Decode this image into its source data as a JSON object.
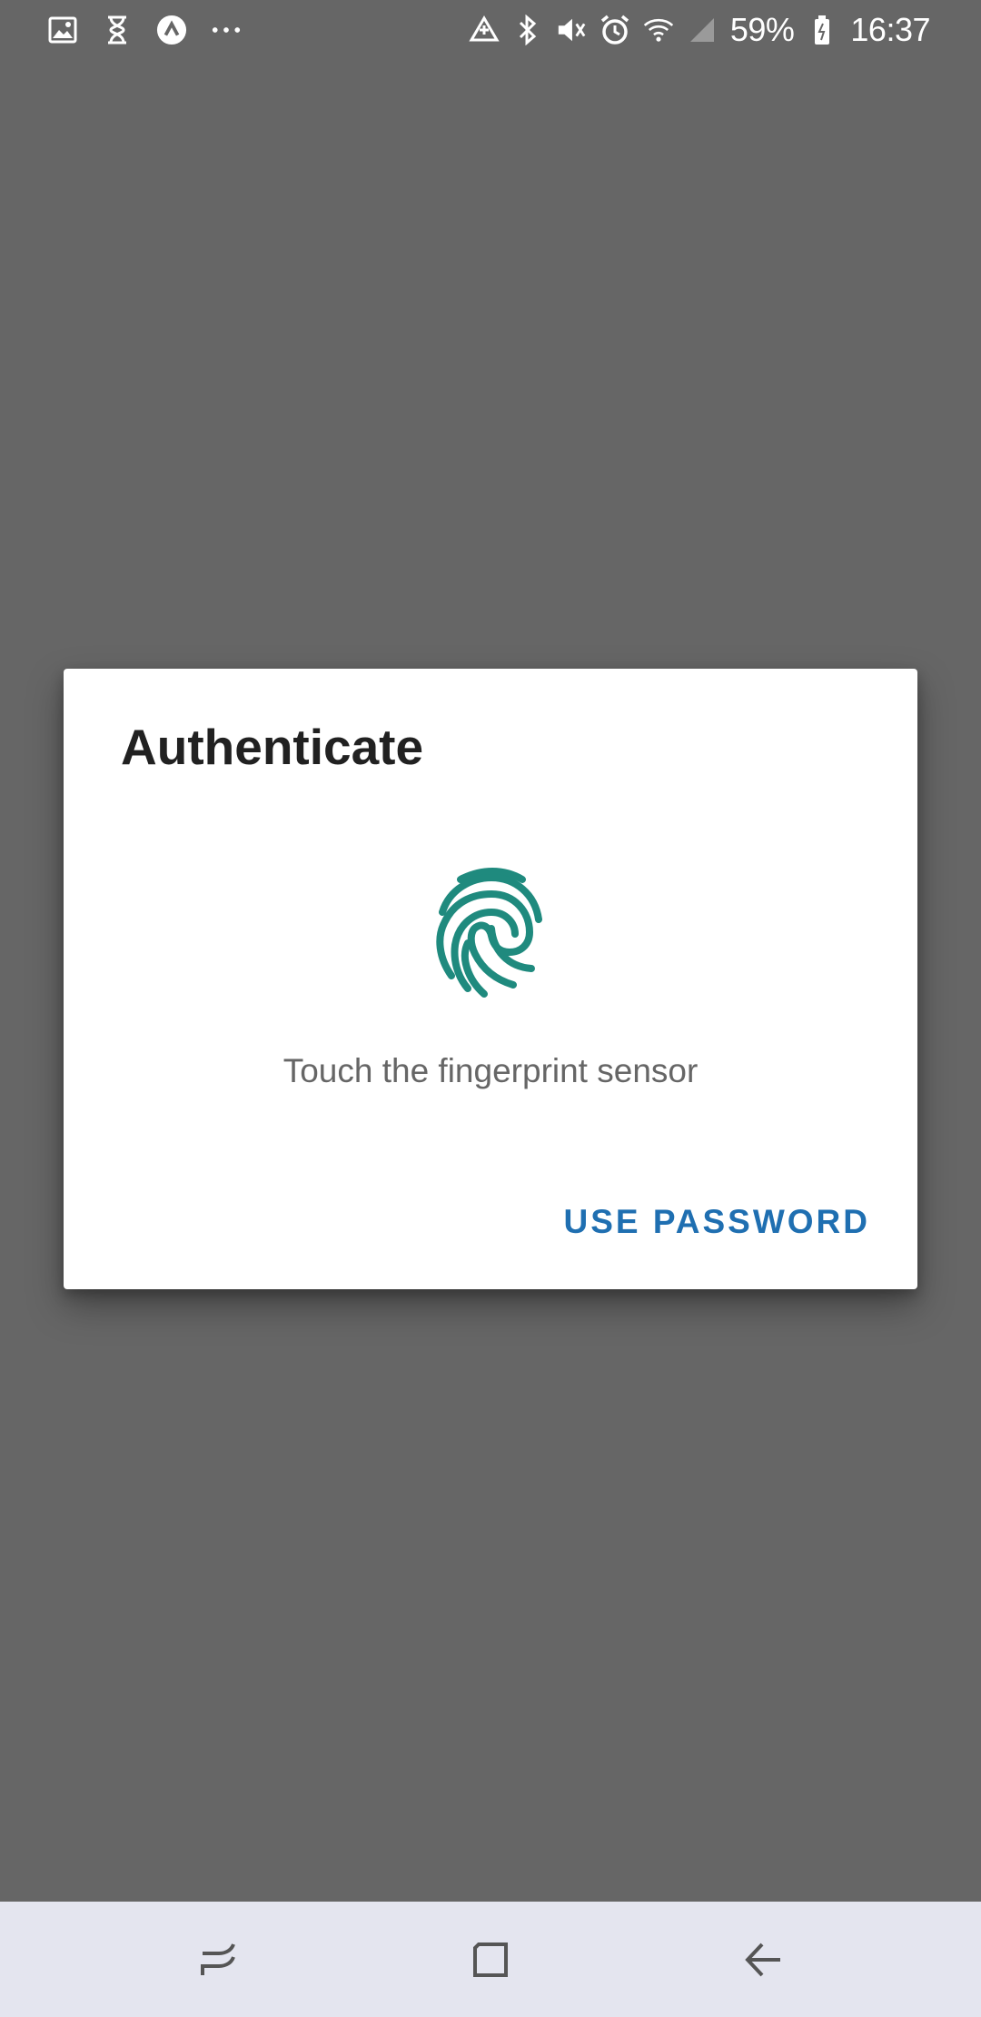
{
  "status_bar": {
    "battery": "59%",
    "time": "16:37",
    "left_icons": [
      "image-icon",
      "hourglass-icon",
      "app-icon",
      "more-dots-icon"
    ],
    "right_icons": [
      "data-saver-icon",
      "bluetooth-icon",
      "mute-icon",
      "alarm-icon",
      "wifi-icon",
      "signal-icon",
      "battery-icon"
    ]
  },
  "dialog": {
    "title": "Authenticate",
    "message": "Touch the fingerprint sensor",
    "button_label": "USE PASSWORD",
    "icon": "fingerprint-icon",
    "accent_color": "#1F8A7E",
    "button_color": "#1F6FB1"
  },
  "nav_bar": {
    "buttons": [
      "recents-icon",
      "home-icon",
      "back-icon"
    ]
  },
  "colors": {
    "scrim": "#666666",
    "nav_bar_bg": "#E4E5EF"
  }
}
